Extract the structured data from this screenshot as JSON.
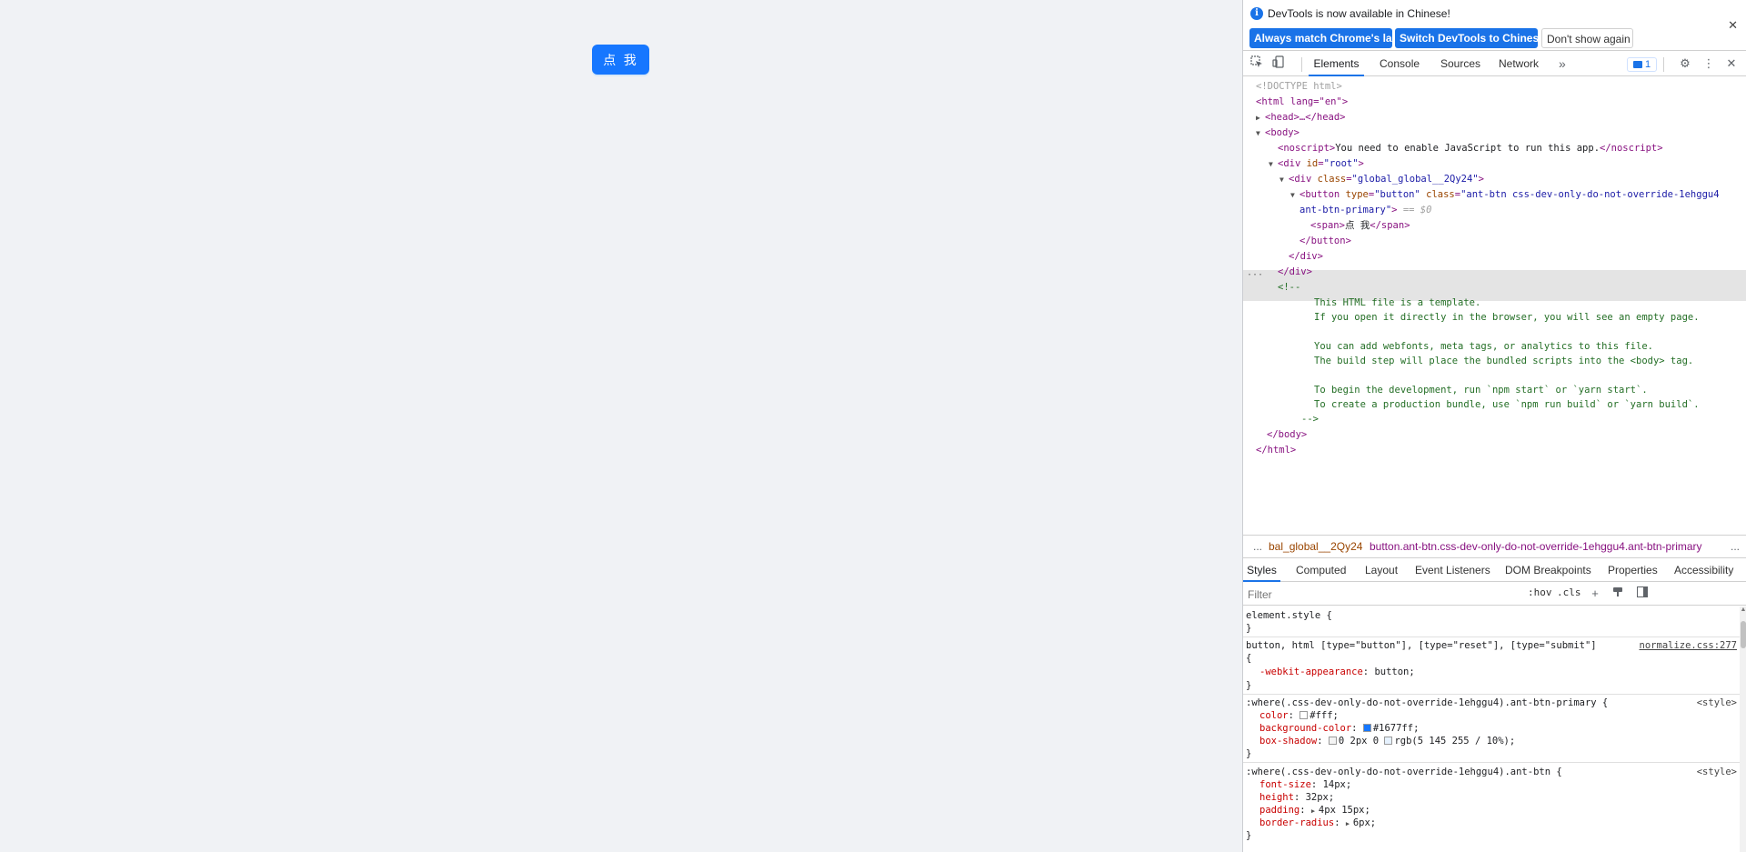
{
  "page": {
    "button_label": "点 我"
  },
  "devtools": {
    "infobar": {
      "message": "DevTools is now available in Chinese!",
      "btn_match": "Always match Chrome's language",
      "btn_switch": "Switch DevTools to Chinese",
      "btn_dont": "Don't show again"
    },
    "tabs": [
      "Elements",
      "Console",
      "Sources",
      "Network"
    ],
    "issues_count": "1",
    "dom": {
      "doctype": "<!DOCTYPE html>",
      "html_open": "<html lang=\"en\">",
      "head": "<head>…</head>",
      "body_open": "<body>",
      "noscript_text": "You need to enable JavaScript to run this app.",
      "root_id": "root",
      "global_class": "global_global__2Qy24",
      "button_type": "button",
      "button_class_1": "ant-btn css-dev-only-do-not-override-1ehggu4",
      "button_class_2": "ant-btn-primary",
      "dollar0": "== $0",
      "span_text": "点 我",
      "comment_lines": [
        "This HTML file is a template.",
        "If you open it directly in the browser, you will see an empty page.",
        "",
        "You can add webfonts, meta tags, or analytics to this file.",
        "The build step will place the bundled scripts into the <body> tag.",
        "",
        "To begin the development, run `npm start` or `yarn start`.",
        "To create a production bundle, use `npm run build` or `yarn build`."
      ]
    },
    "breadcrumbs": {
      "left_ellipsis": "...",
      "item1": "bal_global__2Qy24",
      "item2": "button.ant-btn.css-dev-only-do-not-override-1ehggu4.ant-btn-primary",
      "right_ellipsis": "..."
    },
    "style_tabs": [
      "Styles",
      "Computed",
      "Layout",
      "Event Listeners",
      "DOM Breakpoints",
      "Properties",
      "Accessibility"
    ],
    "filter_placeholder": "Filter",
    "hov": ":hov",
    "cls": ".cls",
    "styles": {
      "element_style": "element.style {",
      "rule1_selector": "button, html [type=\"button\"],",
      "rule1_selector_muted": " [type=\"reset\"], [type=\"submit\"]",
      "rule1_source": "normalize.css:277",
      "rule1_prop": "-webkit-appearance",
      "rule1_val": "button;",
      "rule2_selector": ":where(.css-dev-only-do-not-override-1ehggu4).ant-btn-primary {",
      "rule2_source": "<style>",
      "rule2_props": [
        {
          "name": "color",
          "value": "#fff;",
          "swatch": "#ffffff"
        },
        {
          "name": "background-color",
          "value": "#1677ff;",
          "swatch": "#1677ff"
        },
        {
          "name": "box-shadow",
          "value": "0 2px 0 ",
          "value2": "rgb(5 145 255 / 10%);",
          "swatch": "#e6f2ff"
        }
      ],
      "rule3_selector": ":where(.css-dev-only-do-not-override-1ehggu4).ant-btn {",
      "rule3_source": "<style>",
      "rule3_props": [
        {
          "name": "font-size",
          "value": "14px;"
        },
        {
          "name": "height",
          "value": "32px;"
        },
        {
          "name": "padding",
          "value": "4px 15px;"
        },
        {
          "name": "border-radius",
          "value": "6px;"
        }
      ]
    }
  },
  "colors": {
    "primary": "#1677ff",
    "devtools_accent": "#1a73e8",
    "page_bg": "#f0f2f5"
  }
}
